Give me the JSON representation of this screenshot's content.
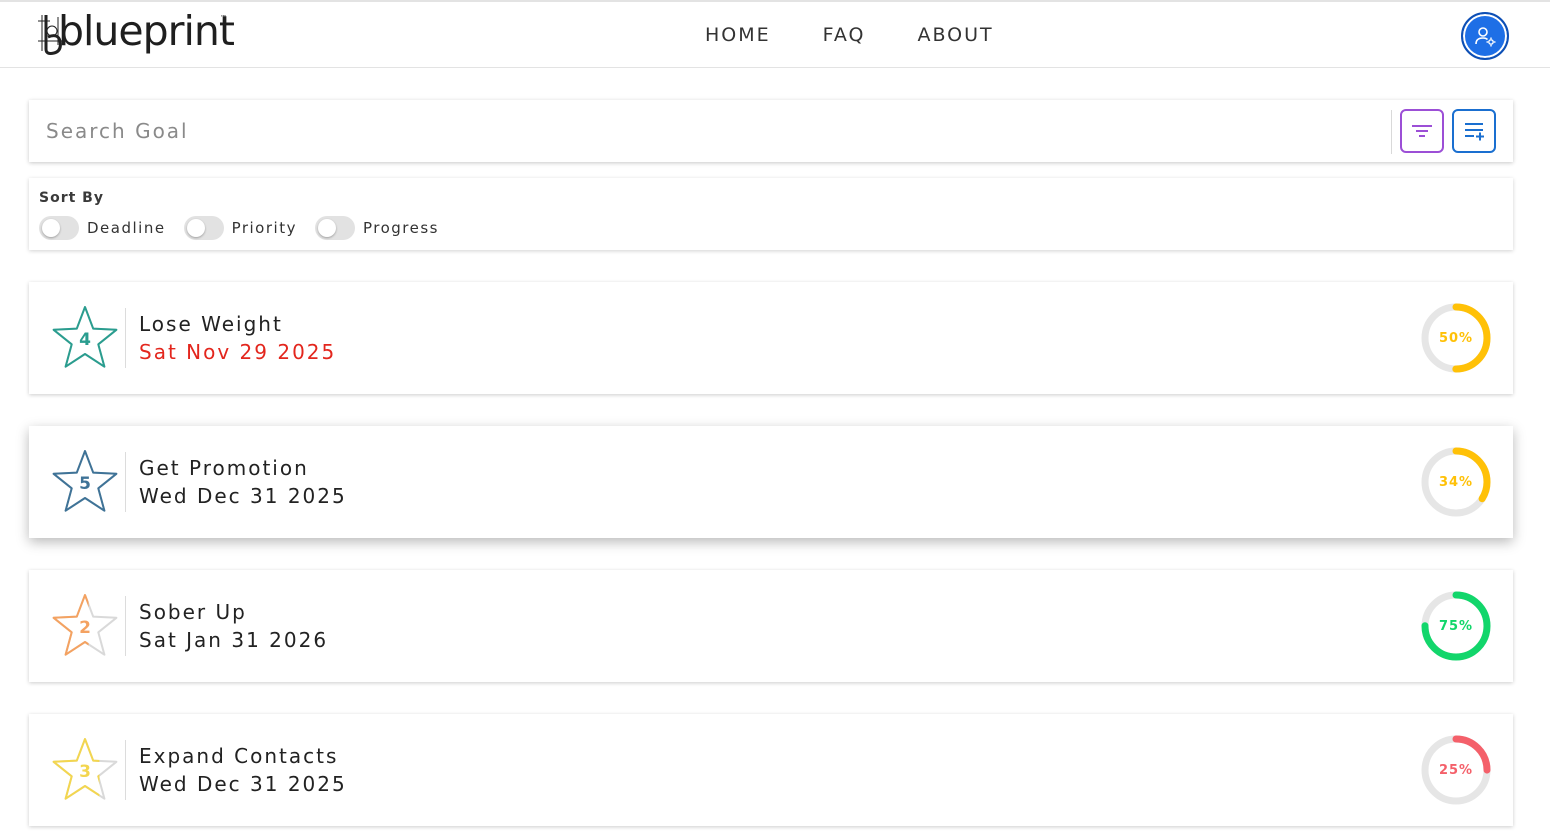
{
  "header": {
    "logo_text": "blueprint",
    "logo_tm": "™",
    "nav": [
      {
        "label": "HOME"
      },
      {
        "label": "FAQ"
      },
      {
        "label": "ABOUT"
      }
    ],
    "avatar_icon": "user-settings-icon"
  },
  "search": {
    "placeholder": "Search Goal",
    "value": "",
    "filter_icon": "filter-icon",
    "add_icon": "add-list-icon",
    "filter_color": "#9c4fd6",
    "add_color": "#1a6fd0"
  },
  "sort": {
    "title": "Sort By",
    "options": [
      {
        "label": "Deadline",
        "on": false
      },
      {
        "label": "Priority",
        "on": false
      },
      {
        "label": "Progress",
        "on": false
      }
    ]
  },
  "goals": [
    {
      "title": "Lose Weight",
      "date": "Sat Nov 29 2025",
      "overdue": true,
      "priority": "4",
      "priority_fill": 1.0,
      "star_color": "#2a9d8f",
      "progress": 50,
      "progress_label": "50%",
      "ring_color": "#ffc107"
    },
    {
      "title": "Get Promotion",
      "date": "Wed Dec 31 2025",
      "overdue": false,
      "priority": "5",
      "priority_fill": 1.0,
      "star_color": "#3f7397",
      "progress": 34,
      "progress_label": "34%",
      "ring_color": "#ffc107"
    },
    {
      "title": "Sober Up",
      "date": "Sat Jan 31 2026",
      "overdue": false,
      "priority": "2",
      "priority_fill": 0.4,
      "star_color": "#f4a261",
      "progress": 75,
      "progress_label": "75%",
      "ring_color": "#12d66b"
    },
    {
      "title": "Expand Contacts",
      "date": "Wed Dec 31 2025",
      "overdue": false,
      "priority": "3",
      "priority_fill": 0.6,
      "star_color": "#f3d64f",
      "progress": 25,
      "progress_label": "25%",
      "ring_color": "#f4606a"
    }
  ]
}
